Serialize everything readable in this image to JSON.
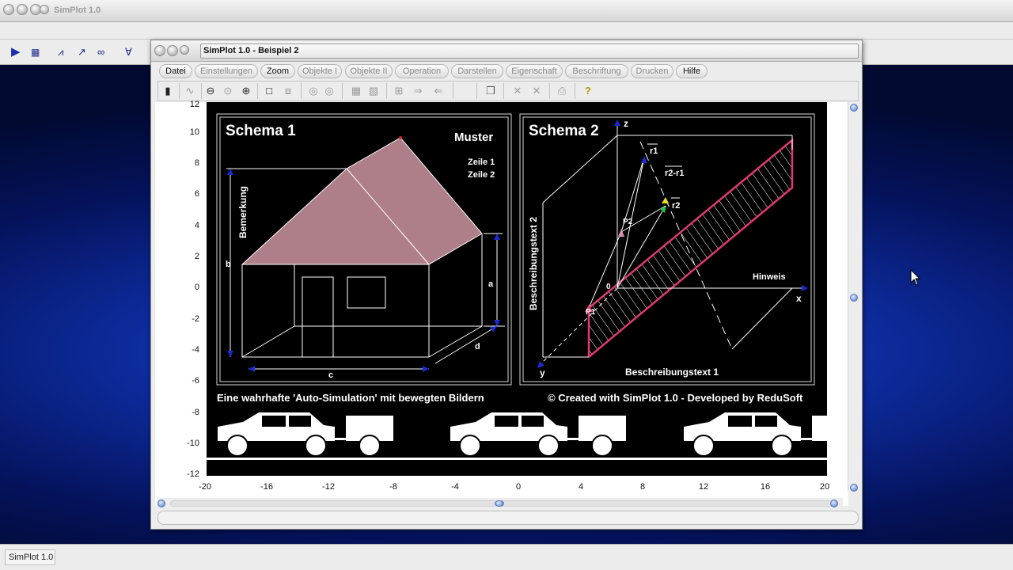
{
  "app": {
    "title": "SimPlot 1.0",
    "status_text": "SimPlot 1.0"
  },
  "window": {
    "title": "SimPlot 1.0 - Beispiel 2"
  },
  "menu": {
    "items": [
      "Datei",
      "Einstellungen",
      "Zoom",
      "Objekte I",
      "Objekte II",
      "Operation",
      "Darstellen",
      "Eigenschaft",
      "Beschriftung",
      "Drucken",
      "Hilfe"
    ],
    "enabled": [
      true,
      false,
      true,
      false,
      false,
      false,
      false,
      false,
      false,
      false,
      true
    ]
  },
  "axes": {
    "y_ticks": [
      "12",
      "10",
      "8",
      "6",
      "4",
      "2",
      "0",
      "-2",
      "-4",
      "-6",
      "-8",
      "-10",
      "-12"
    ],
    "x_ticks": [
      "-20",
      "-16",
      "-12",
      "-8",
      "-4",
      "0",
      "4",
      "8",
      "12",
      "16",
      "20"
    ]
  },
  "schema1": {
    "title": "Schema 1",
    "label_muster": "Muster",
    "label_zeile1": "Zeile 1",
    "label_zeile2": "Zeile 2",
    "label_bemerkung": "Bemerkung",
    "dim_a": "a",
    "dim_b": "b",
    "dim_c": "c",
    "dim_d": "d",
    "roof_color": "#ae7f88"
  },
  "schema2": {
    "title": "Schema 2",
    "axis_x": "x",
    "axis_y": "y",
    "axis_z": "z",
    "origin": "0",
    "label_r1": "r1",
    "label_r2": "r2",
    "label_r2r1": "r2-r1",
    "label_p1": "P1",
    "label_p2": "P2",
    "label_hinweis": "Hinweis",
    "label_text1": "Beschreibungstext 1",
    "label_text2": "Beschreibungstext 2",
    "band_color": "#e03a6e"
  },
  "caption_left": "Eine wahrhafte 'Auto-Simulation' mit bewegten Bildern",
  "caption_right": "© Created with SimPlot 1.0 - Developed by ReduSoft"
}
